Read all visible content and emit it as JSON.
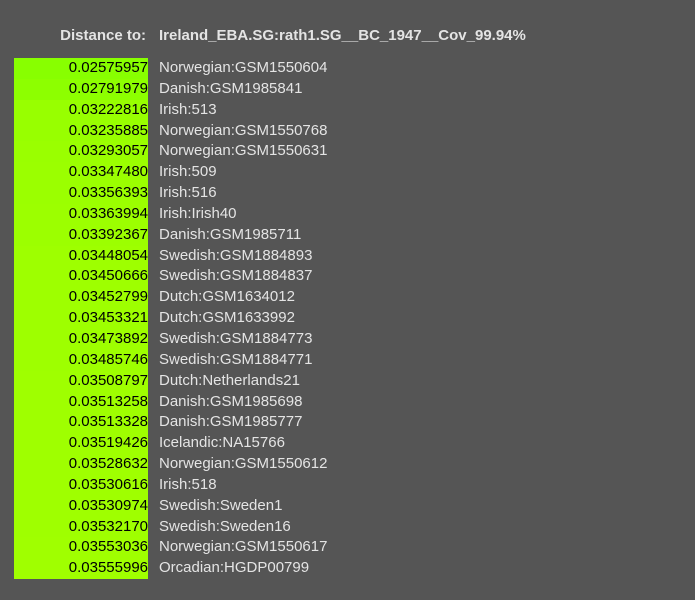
{
  "header": {
    "label": "Distance to:",
    "target": "Ireland_EBA.SG:rath1.SG__BC_1947__Cov_99.94%"
  },
  "rows": [
    {
      "distance": "0.02575957",
      "population": "Norwegian:GSM1550604",
      "color": "#88ff00"
    },
    {
      "distance": "0.02791979",
      "population": "Danish:GSM1985841",
      "color": "#8dff00"
    },
    {
      "distance": "0.03222816",
      "population": "Irish:513",
      "color": "#98ff00"
    },
    {
      "distance": "0.03235885",
      "population": "Norwegian:GSM1550768",
      "color": "#98ff00"
    },
    {
      "distance": "0.03293057",
      "population": "Norwegian:GSM1550631",
      "color": "#9aff00"
    },
    {
      "distance": "0.03347480",
      "population": "Irish:509",
      "color": "#9bff00"
    },
    {
      "distance": "0.03356393",
      "population": "Irish:516",
      "color": "#9bff00"
    },
    {
      "distance": "0.03363994",
      "population": "Irish:Irish40",
      "color": "#9cff00"
    },
    {
      "distance": "0.03392367",
      "population": "Danish:GSM1985711",
      "color": "#9cff00"
    },
    {
      "distance": "0.03448054",
      "population": "Swedish:GSM1884893",
      "color": "#9eff00"
    },
    {
      "distance": "0.03450666",
      "population": "Swedish:GSM1884837",
      "color": "#9eff00"
    },
    {
      "distance": "0.03452799",
      "population": "Dutch:GSM1634012",
      "color": "#9eff00"
    },
    {
      "distance": "0.03453321",
      "population": "Dutch:GSM1633992",
      "color": "#9eff00"
    },
    {
      "distance": "0.03473892",
      "population": "Swedish:GSM1884773",
      "color": "#9eff00"
    },
    {
      "distance": "0.03485746",
      "population": "Swedish:GSM1884771",
      "color": "#9eff00"
    },
    {
      "distance": "0.03508797",
      "population": "Dutch:Netherlands21",
      "color": "#9fff00"
    },
    {
      "distance": "0.03513258",
      "population": "Danish:GSM1985698",
      "color": "#9fff00"
    },
    {
      "distance": "0.03513328",
      "population": "Danish:GSM1985777",
      "color": "#9fff00"
    },
    {
      "distance": "0.03519426",
      "population": "Icelandic:NA15766",
      "color": "#9fff00"
    },
    {
      "distance": "0.03528632",
      "population": "Norwegian:GSM1550612",
      "color": "#9fff00"
    },
    {
      "distance": "0.03530616",
      "population": "Irish:518",
      "color": "#9fff00"
    },
    {
      "distance": "0.03530974",
      "population": "Swedish:Sweden1",
      "color": "#9fff00"
    },
    {
      "distance": "0.03532170",
      "population": "Swedish:Sweden16",
      "color": "#9fff00"
    },
    {
      "distance": "0.03553036",
      "population": "Norwegian:GSM1550617",
      "color": "#a0ff00"
    },
    {
      "distance": "0.03555996",
      "population": "Orcadian:HGDP00799",
      "color": "#a0ff00"
    }
  ]
}
